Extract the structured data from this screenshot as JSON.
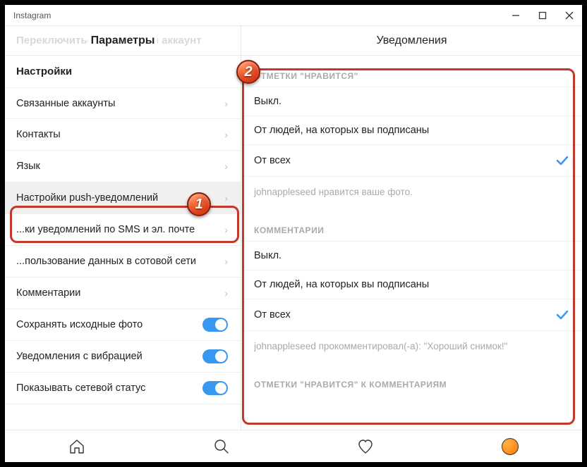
{
  "app": {
    "title": "Instagram"
  },
  "header": {
    "left": "Параметры",
    "right": "Уведомления",
    "ghost": "Переключиться на личный аккаунт"
  },
  "sidebar": {
    "heading": "Настройки",
    "items": [
      {
        "label": "Связанные аккаунты",
        "type": "nav"
      },
      {
        "label": "Контакты",
        "type": "nav"
      },
      {
        "label": "Язык",
        "type": "nav"
      },
      {
        "label": "Настройки push-уведомлений",
        "type": "nav",
        "selected": true
      },
      {
        "label": "...ки уведомлений по SMS и эл. почте",
        "type": "nav"
      },
      {
        "label": "...пользование данных в сотовой сети",
        "type": "nav"
      },
      {
        "label": "Комментарии",
        "type": "nav"
      },
      {
        "label": "Сохранять исходные фото",
        "type": "toggle",
        "on": true
      },
      {
        "label": "Уведомления с вибрацией",
        "type": "toggle",
        "on": true
      },
      {
        "label": "Показывать сетевой статус",
        "type": "toggle",
        "on": true
      }
    ]
  },
  "content": {
    "sections": [
      {
        "title": "ОТМЕТКИ \"НРАВИТСЯ\"",
        "options": [
          {
            "label": "Выкл.",
            "checked": false
          },
          {
            "label": "От людей, на которых вы подписаны",
            "checked": false
          },
          {
            "label": "От всех",
            "checked": true
          }
        ],
        "hint": "johnappleseed нравится ваше фото."
      },
      {
        "title": "КОММЕНТАРИИ",
        "options": [
          {
            "label": "Выкл.",
            "checked": false
          },
          {
            "label": "От людей, на которых вы подписаны",
            "checked": false
          },
          {
            "label": "От всех",
            "checked": true
          }
        ],
        "hint": "johnappleseed прокомментировал(-а): \"Хороший снимок!\""
      },
      {
        "title": "ОТМЕТКИ \"НРАВИТСЯ\" К КОММЕНТАРИЯМ",
        "options": [],
        "hint": ""
      }
    ]
  },
  "annotations": {
    "badge1": "1",
    "badge2": "2"
  }
}
